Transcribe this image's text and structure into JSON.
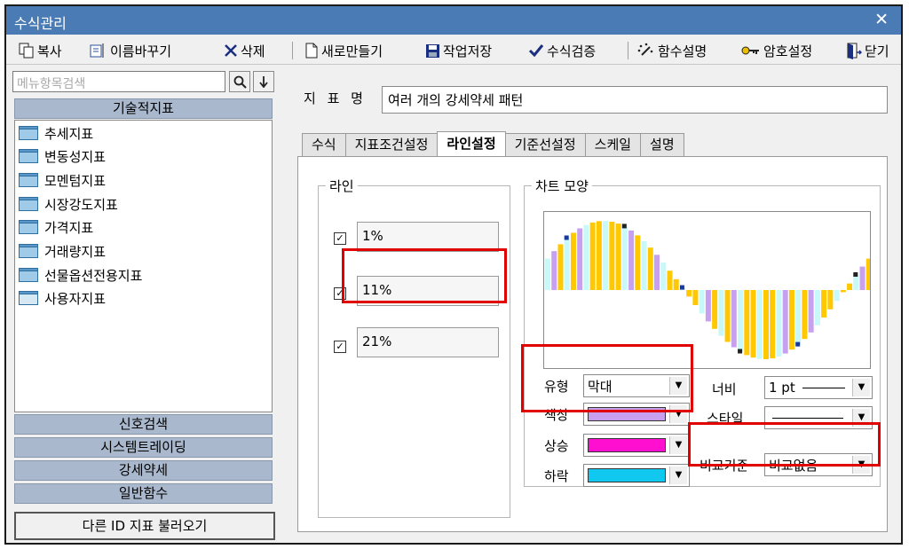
{
  "window": {
    "title": "수식관리",
    "close_glyph": "✕"
  },
  "toolbar": {
    "copy": "복사",
    "rename": "이름바꾸기",
    "delete": "삭제",
    "new": "새로만들기",
    "save": "작업저장",
    "verify": "수식검증",
    "func_desc": "함수설명",
    "password": "암호설정",
    "close": "닫기"
  },
  "sidebar": {
    "search_placeholder": "메뉴항목검색",
    "header": "기술적지표",
    "items": [
      "추세지표",
      "변동성지표",
      "모멘텀지표",
      "시장강도지표",
      "가격지표",
      "거래량지표",
      "선물옵션전용지표",
      "사용자지표"
    ],
    "categories": [
      "신호검색",
      "시스템트레이딩",
      "강세약세",
      "일반함수"
    ],
    "load_button": "다른 ID 지표 불러오기"
  },
  "indicator": {
    "label": "지 표 명",
    "name": "여러 개의 강세약세 패턴"
  },
  "tabs": [
    "수식",
    "지표조건설정",
    "라인설정",
    "기준선설정",
    "스케일",
    "설명"
  ],
  "active_tab": "라인설정",
  "line_group": {
    "title": "라인",
    "lines": [
      {
        "checked": true,
        "value": "1%"
      },
      {
        "checked": true,
        "value": "11%"
      },
      {
        "checked": true,
        "value": "21%"
      }
    ]
  },
  "chart_group": {
    "title": "차트 모양",
    "type_label": "유형",
    "type_value": "막대",
    "color_label": "색상",
    "up_label": "상승",
    "down_label": "하락",
    "width_label": "너비",
    "width_value": "1 pt",
    "style_label": "스타일",
    "compare_label": "비교기준",
    "compare_value": "비교없음"
  },
  "colors": {
    "titlebar": "#4a7bb4",
    "line_color": "#c8a0f0",
    "up_color": "#ff10d0",
    "down_color": "#10c8f0",
    "bar_yellow": "#ffc800",
    "bar_cyan": "#c8f8f8",
    "bar_purple": "#c8a0f0",
    "highlight_red": "#e00000"
  },
  "icons": {
    "copy": "copy-icon",
    "rename": "rename-icon",
    "delete": "delete-icon",
    "new": "new-document-icon",
    "save": "save-icon",
    "verify": "checkmark-icon",
    "func_desc": "magic-wand-icon",
    "password": "key-icon",
    "close": "exit-door-icon",
    "search": "search-icon",
    "sort": "down-arrow-icon",
    "folder": "folder-icon"
  }
}
